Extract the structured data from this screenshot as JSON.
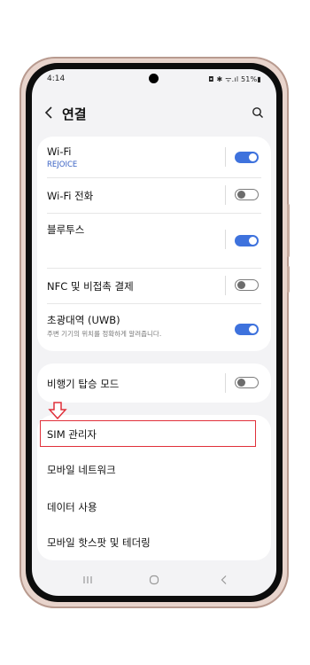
{
  "status_bar": {
    "time": "4:14",
    "right_icons": "◘ ✱ ᯤ.ıl 51%▮"
  },
  "header": {
    "title": "연결",
    "back_icon": "chevron-left-icon",
    "search_icon": "search-icon"
  },
  "group1": {
    "wifi": {
      "label": "Wi-Fi",
      "network": "REJOICE",
      "toggle": "on"
    },
    "wifi_calling": {
      "label": "Wi-Fi 전화",
      "toggle": "off"
    },
    "bluetooth": {
      "label": "블루투스",
      "toggle": "on"
    },
    "nfc": {
      "label": "NFC 및 비접촉 결제",
      "toggle": "off"
    },
    "uwb": {
      "label": "초광대역 (UWB)",
      "desc": "주변 기기의 위치를 정확하게 알려줍니다.",
      "toggle": "on"
    }
  },
  "group2": {
    "airplane": {
      "label": "비행기 탑승 모드",
      "toggle": "off"
    }
  },
  "group3": {
    "sim_manager": "SIM 관리자",
    "mobile_network": "모바일 네트워크",
    "data_usage": "데이터 사용",
    "hotspot": "모바일 핫스팟 및 테더링"
  },
  "colors": {
    "toggle_on": "#3e72dd",
    "highlight": "#e0303a",
    "accent_text": "#3a62c4"
  }
}
